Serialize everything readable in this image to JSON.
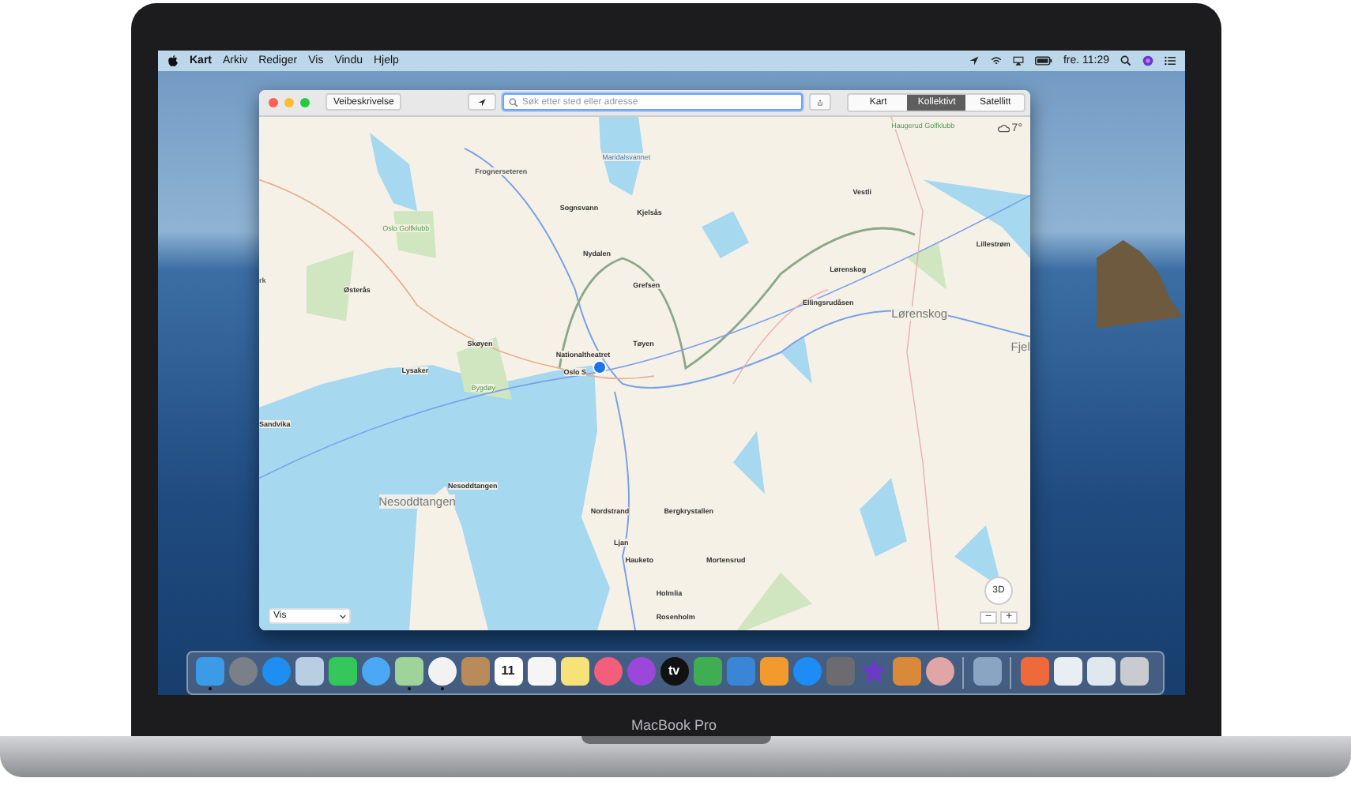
{
  "menu_bar": {
    "app_name": "Kart",
    "items": [
      "Arkiv",
      "Rediger",
      "Vis",
      "Vindu",
      "Hjelp"
    ],
    "clock": "fre. 11:29"
  },
  "maps_window": {
    "directions_button": "Veibeskrivelse",
    "search": {
      "placeholder": "Søk etter sted eller adresse"
    },
    "tabs": [
      {
        "label": "Kart",
        "selected": false
      },
      {
        "label": "Kollektivt",
        "selected": true
      },
      {
        "label": "Satellitt",
        "selected": false
      }
    ],
    "weather": "7°",
    "map_labels": [
      {
        "text": "Haugerud Golfklubb",
        "kind": "park"
      },
      {
        "text": "Maridalsvannet",
        "kind": "water"
      },
      {
        "text": "Frognerseteren",
        "kind": "place"
      },
      {
        "text": "Vestli",
        "kind": "station"
      },
      {
        "text": "Sognsvann",
        "kind": "station"
      },
      {
        "text": "Kjelsås",
        "kind": "station"
      },
      {
        "text": "Oslo Golfklubb",
        "kind": "park"
      },
      {
        "text": "Lillestrøm",
        "kind": "station"
      },
      {
        "text": "Nydalen",
        "kind": "station"
      },
      {
        "text": "Lørenskog",
        "kind": "station"
      },
      {
        "text": "rk",
        "kind": "place"
      },
      {
        "text": "Grefsen",
        "kind": "station"
      },
      {
        "text": "Østerås",
        "kind": "station"
      },
      {
        "text": "Ellingsrudåsen",
        "kind": "station"
      },
      {
        "text": "Lørenskog",
        "kind": "city"
      },
      {
        "text": "Skøyen",
        "kind": "station"
      },
      {
        "text": "Tøyen",
        "kind": "station"
      },
      {
        "text": "Fjel",
        "kind": "city"
      },
      {
        "text": "Nationaltheatret",
        "kind": "station"
      },
      {
        "text": "Lysaker",
        "kind": "station"
      },
      {
        "text": "Oslo S",
        "kind": "station"
      },
      {
        "text": "Bygdøy",
        "kind": "park"
      },
      {
        "text": "Sandvika",
        "kind": "station"
      },
      {
        "text": "Nesoddtangen",
        "kind": "station"
      },
      {
        "text": "Nesoddtangen",
        "kind": "city"
      },
      {
        "text": "Nordstrand",
        "kind": "station"
      },
      {
        "text": "Bergkrystallen",
        "kind": "station"
      },
      {
        "text": "Ljan",
        "kind": "station"
      },
      {
        "text": "Hauketo",
        "kind": "station"
      },
      {
        "text": "Mortensrud",
        "kind": "station"
      },
      {
        "text": "Holmlia",
        "kind": "station"
      },
      {
        "text": "Rosenholm",
        "kind": "station"
      }
    ],
    "show_menu": "Vis",
    "compass_label": "3D",
    "zoom_out": "−",
    "zoom_in": "+"
  },
  "dock": [
    {
      "kind": "square",
      "color": "#3b9be6",
      "running": true
    },
    {
      "kind": "circle",
      "color": "#7a7f88",
      "running": false
    },
    {
      "kind": "circle",
      "color": "#1e8ff0",
      "running": false
    },
    {
      "kind": "square",
      "color": "#b9cde3",
      "running": false
    },
    {
      "kind": "square",
      "color": "#34c759",
      "running": false
    },
    {
      "kind": "circle",
      "color": "#4aa8f5",
      "running": false
    },
    {
      "kind": "square",
      "color": "#9fd39a",
      "running": true
    },
    {
      "kind": "circle",
      "color": "#f2f2f2",
      "running": true
    },
    {
      "kind": "square",
      "color": "#b98a5a",
      "running": false
    },
    {
      "kind": "square",
      "color": "#ffffff",
      "running": false,
      "label": "11"
    },
    {
      "kind": "square",
      "color": "#f5f5f5",
      "running": false
    },
    {
      "kind": "square",
      "color": "#f7e27a",
      "running": false
    },
    {
      "kind": "circle",
      "color": "#f35f7a",
      "running": false
    },
    {
      "kind": "circle",
      "color": "#9b47d9",
      "running": false
    },
    {
      "kind": "circle",
      "color": "#111111",
      "running": false,
      "label": "tv"
    },
    {
      "kind": "square",
      "color": "#3fae52",
      "running": false
    },
    {
      "kind": "square",
      "color": "#3a86d6",
      "running": false
    },
    {
      "kind": "square",
      "color": "#f29a2e",
      "running": false
    },
    {
      "kind": "circle",
      "color": "#1d8cf5",
      "running": false
    },
    {
      "kind": "square",
      "color": "#6c6c70",
      "running": false
    },
    {
      "kind": "star",
      "color": "#6a3bc5",
      "running": false
    },
    {
      "kind": "square",
      "color": "#d88a3a",
      "running": false
    },
    {
      "kind": "circle",
      "color": "#e0a5a5",
      "running": false
    },
    {
      "kind": "separator"
    },
    {
      "kind": "square",
      "color": "#8aa4c4",
      "running": false
    },
    {
      "kind": "separator"
    },
    {
      "kind": "square",
      "color": "#ee6a3a",
      "running": false
    },
    {
      "kind": "square",
      "color": "#e8eef4",
      "running": false
    },
    {
      "kind": "square",
      "color": "#dfe7ef",
      "running": false
    },
    {
      "kind": "square",
      "color": "#c8ccd0",
      "running": false
    }
  ],
  "laptop_label": "MacBook Pro"
}
